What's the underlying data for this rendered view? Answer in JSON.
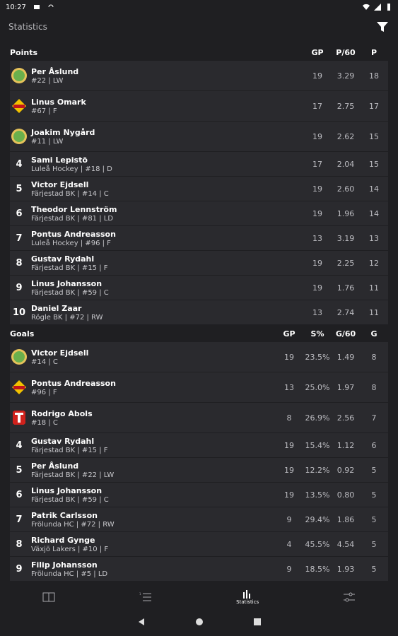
{
  "status_bar": {
    "time": "10:27"
  },
  "app_bar": {
    "title": "Statistics"
  },
  "points": {
    "label": "Points",
    "cols": [
      "GP",
      "P/60",
      "P"
    ],
    "rows": [
      {
        "rank": "",
        "logo": "farjestad",
        "name": "Per Åslund",
        "sub": "#22 | LW",
        "v": [
          "19",
          "3.29",
          "18"
        ]
      },
      {
        "rank": "",
        "logo": "lulea",
        "name": "Linus Omark",
        "sub": "#67 | F",
        "v": [
          "17",
          "2.75",
          "17"
        ]
      },
      {
        "rank": "",
        "logo": "farjestad",
        "name": "Joakim Nygård",
        "sub": "#11 | LW",
        "v": [
          "19",
          "2.62",
          "15"
        ]
      },
      {
        "rank": "4",
        "logo": "",
        "name": "Sami Lepistö",
        "sub": "Luleå Hockey | #18 | D",
        "v": [
          "17",
          "2.04",
          "15"
        ]
      },
      {
        "rank": "5",
        "logo": "",
        "name": "Victor Ejdsell",
        "sub": "Färjestad BK | #14 | C",
        "v": [
          "19",
          "2.60",
          "14"
        ]
      },
      {
        "rank": "6",
        "logo": "",
        "name": "Theodor Lennström",
        "sub": "Färjestad BK | #81 | LD",
        "v": [
          "19",
          "1.96",
          "14"
        ]
      },
      {
        "rank": "7",
        "logo": "",
        "name": "Pontus Andreasson",
        "sub": "Luleå Hockey | #96 | F",
        "v": [
          "13",
          "3.19",
          "13"
        ]
      },
      {
        "rank": "8",
        "logo": "",
        "name": "Gustav Rydahl",
        "sub": "Färjestad BK | #15 | F",
        "v": [
          "19",
          "2.25",
          "12"
        ]
      },
      {
        "rank": "9",
        "logo": "",
        "name": "Linus Johansson",
        "sub": "Färjestad BK | #59 | C",
        "v": [
          "19",
          "1.76",
          "11"
        ]
      },
      {
        "rank": "10",
        "logo": "",
        "name": "Daniel Zaar",
        "sub": "Rögle BK | #72 | RW",
        "v": [
          "13",
          "2.74",
          "11"
        ]
      }
    ]
  },
  "goals": {
    "label": "Goals",
    "cols": [
      "GP",
      "S%",
      "G/60",
      "G"
    ],
    "rows": [
      {
        "rank": "",
        "logo": "farjestad",
        "name": "Victor Ejdsell",
        "sub": "#14 | C",
        "v": [
          "19",
          "23.5%",
          "1.49",
          "8"
        ]
      },
      {
        "rank": "",
        "logo": "lulea",
        "name": "Pontus Andreasson",
        "sub": "#96 | F",
        "v": [
          "13",
          "25.0%",
          "1.97",
          "8"
        ]
      },
      {
        "rank": "",
        "logo": "timra",
        "name": "Rodrigo Abols",
        "sub": "#18 | C",
        "v": [
          "8",
          "26.9%",
          "2.56",
          "7"
        ]
      },
      {
        "rank": "4",
        "logo": "",
        "name": "Gustav Rydahl",
        "sub": "Färjestad BK | #15 | F",
        "v": [
          "19",
          "15.4%",
          "1.12",
          "6"
        ]
      },
      {
        "rank": "5",
        "logo": "",
        "name": "Per Åslund",
        "sub": "Färjestad BK | #22 | LW",
        "v": [
          "19",
          "12.2%",
          "0.92",
          "5"
        ]
      },
      {
        "rank": "6",
        "logo": "",
        "name": "Linus Johansson",
        "sub": "Färjestad BK | #59 | C",
        "v": [
          "19",
          "13.5%",
          "0.80",
          "5"
        ]
      },
      {
        "rank": "7",
        "logo": "",
        "name": "Patrik Carlsson",
        "sub": "Frölunda HC | #72 | RW",
        "v": [
          "9",
          "29.4%",
          "1.86",
          "5"
        ]
      },
      {
        "rank": "8",
        "logo": "",
        "name": "Richard Gynge",
        "sub": "Växjö Lakers | #10 | F",
        "v": [
          "4",
          "45.5%",
          "4.54",
          "5"
        ]
      },
      {
        "rank": "9",
        "logo": "",
        "name": "Filip Johansson",
        "sub": "Frölunda HC | #5 | LD",
        "v": [
          "9",
          "18.5%",
          "1.93",
          "5"
        ]
      }
    ]
  },
  "bottom_nav": [
    {
      "label": "",
      "icon": "scoreboard-icon"
    },
    {
      "label": "",
      "icon": "list-icon"
    },
    {
      "label": "Statistics",
      "icon": "stats-icon"
    },
    {
      "label": "",
      "icon": "settings-icon"
    }
  ],
  "colors": {
    "bg": "#1f1f22",
    "row": "#2a2a2e",
    "farjestad": "#6ab04c",
    "lulea": "#f2c200",
    "timra": "#d0211c"
  }
}
